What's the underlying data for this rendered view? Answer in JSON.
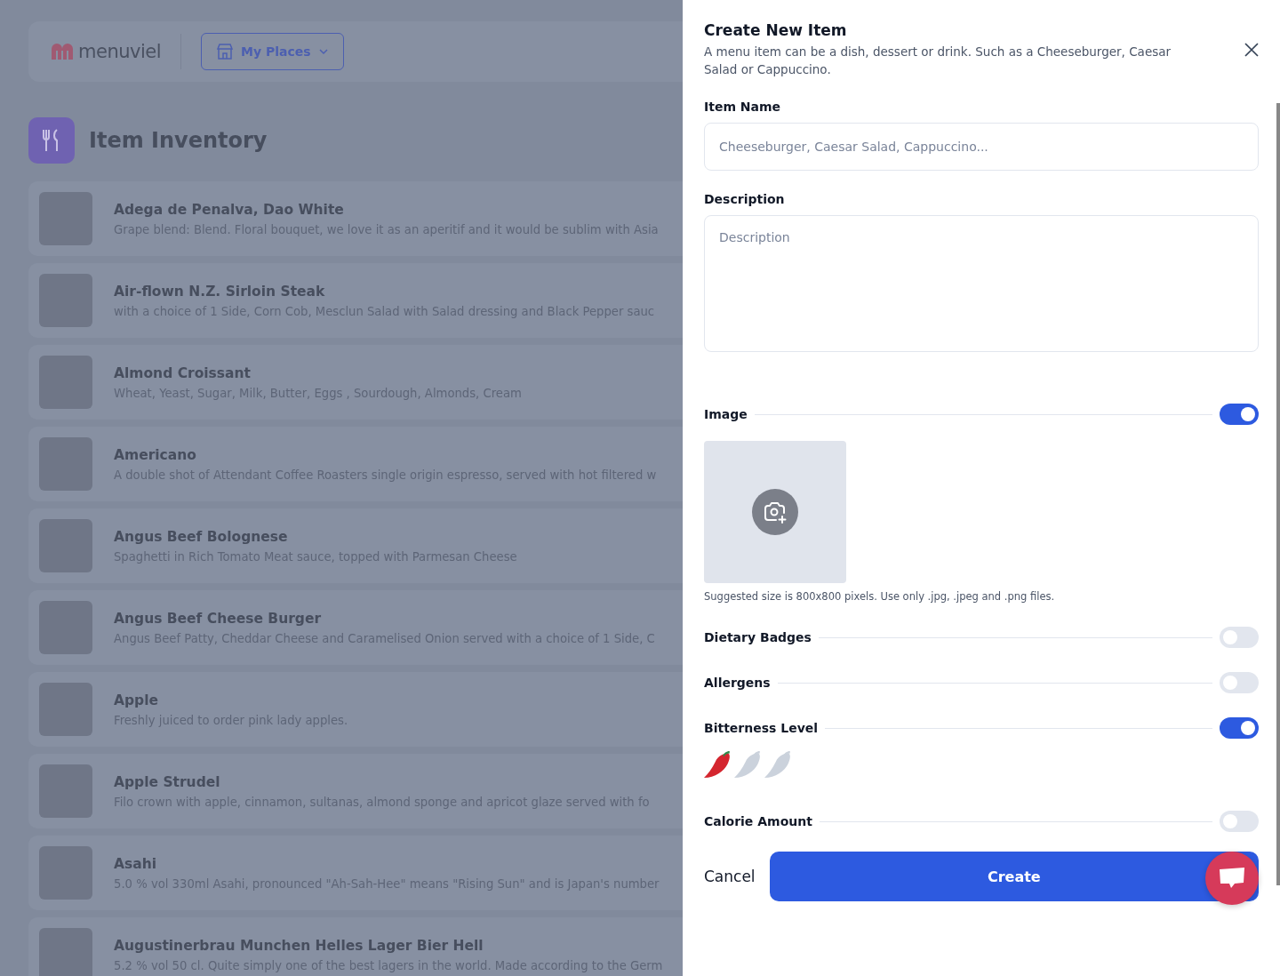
{
  "header": {
    "logo": "menuviel",
    "places_button": "My Places"
  },
  "page": {
    "title": "Item Inventory"
  },
  "items": [
    {
      "name": "Adega de Penalva, Dao White",
      "description": "Grape blend: Blend. Floral bouquet, we love it as an aperitif and it would be sublim with Asia"
    },
    {
      "name": "Air-flown N.Z. Sirloin Steak",
      "description": "with a choice of 1 Side, Corn Cob, Mesclun Salad with Salad dressing and Black Pepper sauc"
    },
    {
      "name": "Almond Croissant",
      "description": "Wheat, Yeast, Sugar, Milk, Butter, Eggs , Sourdough, Almonds, Cream"
    },
    {
      "name": "Americano",
      "description": "A double shot of Attendant Coffee Roasters single origin espresso, served with hot filtered w"
    },
    {
      "name": "Angus Beef Bolognese",
      "description": "Spaghetti in Rich Tomato Meat sauce, topped with Parmesan Cheese"
    },
    {
      "name": "Angus Beef Cheese Burger",
      "description": "Angus Beef Patty, Cheddar Cheese and Caramelised Onion served with a choice of 1 Side, C"
    },
    {
      "name": "Apple",
      "description": "Freshly juiced to order pink lady apples."
    },
    {
      "name": "Apple Strudel",
      "description": "Filo crown with apple, cinnamon, sultanas, almond sponge and apricot glaze served with fo"
    },
    {
      "name": "Asahi",
      "description": "5.0 % vol 330ml Asahi, pronounced \"Ah-Sah-Hee\" means \"Rising Sun\" and is Japan's number"
    },
    {
      "name": "Augustinerbrau Munchen Helles Lager Bier Hell",
      "description": "5.2 % vol 50 cl. Quite simply one of the best lagers in the world. Made according to the Germ"
    }
  ],
  "drawer": {
    "title": "Create New Item",
    "subtitle": "A menu item can be a dish, dessert or drink. Such as a Cheeseburger, Caesar Salad or Cappuccino.",
    "name_label": "Item Name",
    "name_placeholder": "Cheeseburger, Caesar Salad, Cappuccino...",
    "description_label": "Description",
    "description_placeholder": "Description",
    "sections": [
      {
        "kind": "image",
        "label": "Image",
        "on": true,
        "hint": "Suggested size is 800x800 pixels. Use only .jpg, .jpeg and .png files."
      },
      {
        "kind": "toggle",
        "label": "Dietary Badges",
        "on": false
      },
      {
        "kind": "toggle",
        "label": "Allergens",
        "on": false
      },
      {
        "kind": "rating",
        "label": "Bitterness Level",
        "on": true,
        "stars": 1
      },
      {
        "kind": "toggle",
        "label": "Calorie Amount",
        "on": false
      }
    ],
    "cancel": "Cancel",
    "create": "Create"
  }
}
